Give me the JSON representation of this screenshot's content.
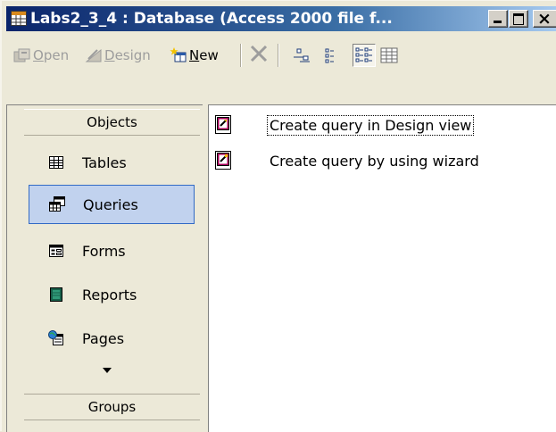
{
  "window": {
    "title": "Labs2_3_4 : Database (Access 2000 file f...",
    "buttons": {
      "minimize": "minimize",
      "maximize": "maximize",
      "close": "close"
    }
  },
  "toolbar": {
    "open_prefix": "O",
    "open_rest": "pen",
    "design_prefix": "D",
    "design_rest": "esign",
    "new_prefix": "N",
    "new_rest": "ew"
  },
  "objects": {
    "header": "Objects",
    "items": [
      {
        "label": "Tables",
        "icon": "table-icon"
      },
      {
        "label": "Queries",
        "icon": "query-icon",
        "selected": true
      },
      {
        "label": "Forms",
        "icon": "form-icon"
      },
      {
        "label": "Reports",
        "icon": "report-icon"
      },
      {
        "label": "Pages",
        "icon": "page-icon"
      }
    ],
    "groups_header": "Groups"
  },
  "list": {
    "items": [
      {
        "label": "Create query in Design view",
        "icon": "create-design-icon",
        "focused": true
      },
      {
        "label": "Create query by using wizard",
        "icon": "create-wizard-icon"
      }
    ]
  },
  "colors": {
    "titlebar_start": "#0a246a",
    "titlebar_end": "#a6caf0",
    "selection": "#c1d2ee",
    "selection_border": "#316ac5"
  }
}
